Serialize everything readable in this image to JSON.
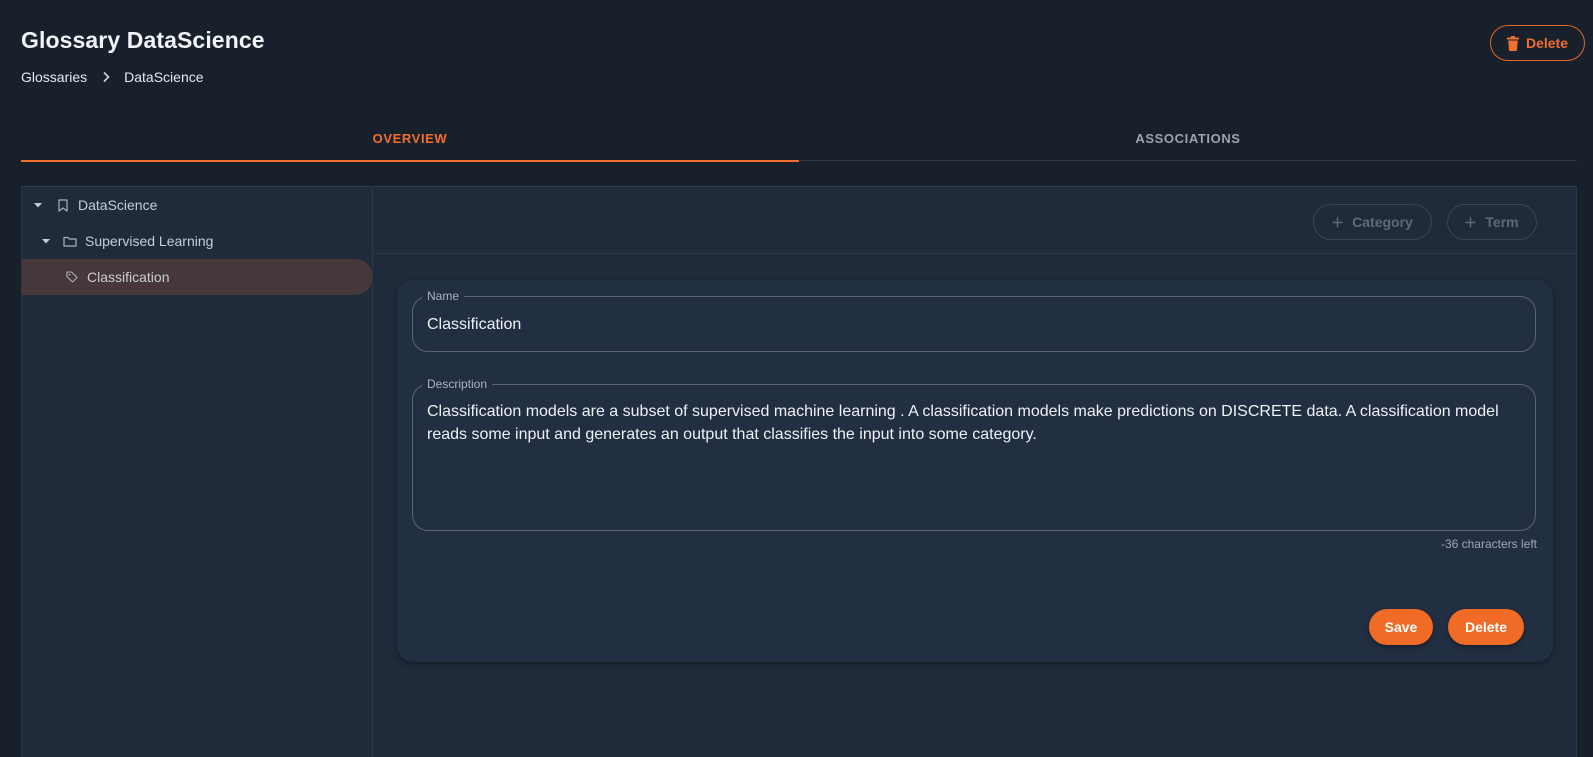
{
  "header": {
    "title": "Glossary DataScience",
    "breadcrumb": [
      "Glossaries",
      "DataScience"
    ],
    "delete_label": "Delete"
  },
  "tabs": [
    {
      "label": "OVERVIEW",
      "active": true
    },
    {
      "label": "ASSOCIATIONS",
      "active": false
    }
  ],
  "tree": {
    "items": [
      {
        "label": "DataScience",
        "icon": "bookmark-icon",
        "expanded": true
      },
      {
        "label": "Supervised Learning",
        "icon": "folder-icon",
        "expanded": true
      },
      {
        "label": "Classification",
        "icon": "tag-icon",
        "selected": true
      }
    ]
  },
  "toolbar": {
    "add_category_label": "Category",
    "add_term_label": "Term"
  },
  "form": {
    "name_label": "Name",
    "name_value": "Classification",
    "description_label": "Description",
    "description_value": "Classification models are a subset of supervised machine learning . A classification models make predictions on DISCRETE data. A classification model reads some input and generates an output that classifies the input into some category.",
    "chars_left": "-36 characters left",
    "save_label": "Save",
    "delete_label": "Delete"
  },
  "colors": {
    "accent": "#f06b25",
    "background": "#18202b",
    "panel": "#1f2a3b",
    "selected_row": "#45373a"
  }
}
